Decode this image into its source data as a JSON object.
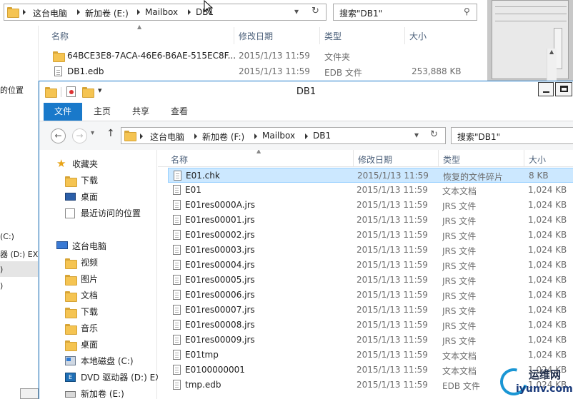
{
  "background_window": {
    "breadcrumb": [
      "这台电脑",
      "新加卷 (E:)",
      "Mailbox",
      "DB1"
    ],
    "search_placeholder": "搜索\"DB1\"",
    "columns": [
      "名称",
      "修改日期",
      "类型",
      "大小"
    ],
    "files": [
      {
        "name": "64BCE3E8-7ACA-46E6-B6AE-515EC8F...",
        "date": "2015/1/13 11:59",
        "type": "文件夹",
        "size": "",
        "icon": "folder-icon"
      },
      {
        "name": "DB1.edb",
        "date": "2015/1/13 11:59",
        "type": "EDB 文件",
        "size": "253,888 KB",
        "icon": "file-icon"
      }
    ],
    "left_fragments": [
      "的位置",
      "(C:)",
      "器 (D:) EX",
      ")",
      ")"
    ]
  },
  "window": {
    "title": "DB1",
    "ribbon_tabs": [
      "文件",
      "主页",
      "共享",
      "查看"
    ],
    "breadcrumb": [
      "这台电脑",
      "新加卷 (F:)",
      "Mailbox",
      "DB1"
    ],
    "search_placeholder": "搜索\"DB1\"",
    "nav": {
      "favorites_label": "收藏夹",
      "favorites": [
        "下载",
        "桌面",
        "最近访问的位置"
      ],
      "this_pc_label": "这台电脑",
      "this_pc": [
        "视频",
        "图片",
        "文档",
        "下载",
        "音乐",
        "桌面",
        "本地磁盘 (C:)",
        "DVD 驱动器 (D:) EX",
        "新加卷 (E:)"
      ]
    },
    "columns": [
      "名称",
      "修改日期",
      "类型",
      "大小"
    ],
    "files": [
      {
        "name": "E01.chk",
        "date": "2015/1/13 11:59",
        "type": "恢复的文件碎片",
        "size": "8 KB",
        "selected": true
      },
      {
        "name": "E01",
        "date": "2015/1/13 11:59",
        "type": "文本文档",
        "size": "1,024 KB"
      },
      {
        "name": "E01res0000A.jrs",
        "date": "2015/1/13 11:59",
        "type": "JRS 文件",
        "size": "1,024 KB"
      },
      {
        "name": "E01res00001.jrs",
        "date": "2015/1/13 11:59",
        "type": "JRS 文件",
        "size": "1,024 KB"
      },
      {
        "name": "E01res00002.jrs",
        "date": "2015/1/13 11:59",
        "type": "JRS 文件",
        "size": "1,024 KB"
      },
      {
        "name": "E01res00003.jrs",
        "date": "2015/1/13 11:59",
        "type": "JRS 文件",
        "size": "1,024 KB"
      },
      {
        "name": "E01res00004.jrs",
        "date": "2015/1/13 11:59",
        "type": "JRS 文件",
        "size": "1,024 KB"
      },
      {
        "name": "E01res00005.jrs",
        "date": "2015/1/13 11:59",
        "type": "JRS 文件",
        "size": "1,024 KB"
      },
      {
        "name": "E01res00006.jrs",
        "date": "2015/1/13 11:59",
        "type": "JRS 文件",
        "size": "1,024 KB"
      },
      {
        "name": "E01res00007.jrs",
        "date": "2015/1/13 11:59",
        "type": "JRS 文件",
        "size": "1,024 KB"
      },
      {
        "name": "E01res00008.jrs",
        "date": "2015/1/13 11:59",
        "type": "JRS 文件",
        "size": "1,024 KB"
      },
      {
        "name": "E01res00009.jrs",
        "date": "2015/1/13 11:59",
        "type": "JRS 文件",
        "size": "1,024 KB"
      },
      {
        "name": "E01tmp",
        "date": "2015/1/13 11:59",
        "type": "文本文档",
        "size": "1,024 KB"
      },
      {
        "name": "E0100000001",
        "date": "2015/1/13 11:59",
        "type": "文本文档",
        "size": "1,024 KB"
      },
      {
        "name": "tmp.edb",
        "date": "2015/1/13 11:59",
        "type": "EDB 文件",
        "size": "1,024 KB"
      }
    ]
  },
  "watermark": {
    "line1": "运维网",
    "line2": "iyunv.com"
  },
  "colors": {
    "accent": "#1979ca",
    "selection": "#cce8ff",
    "header_text": "#4c607a"
  }
}
